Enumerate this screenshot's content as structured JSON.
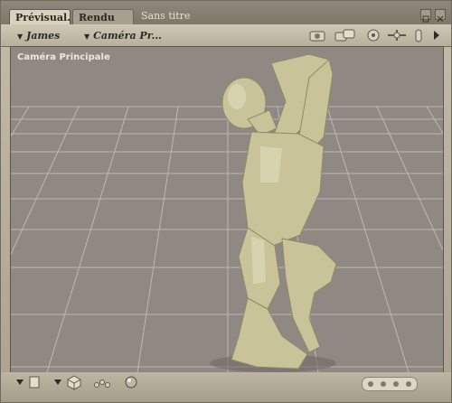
{
  "tabs": [
    {
      "label": "Prévisual.",
      "active": true
    },
    {
      "label": "Rendu",
      "active": false
    }
  ],
  "document": {
    "title": "Sans titre"
  },
  "toolbar": {
    "figure_dropdown": "James",
    "camera_dropdown": "Caméra Pr..."
  },
  "viewport": {
    "camera_label": "Caméra Principale",
    "background_color": "#8f8883",
    "figure_color": "#c9c39a"
  },
  "icons": {
    "window": [
      "restore-icon",
      "close-icon"
    ],
    "toolbar": [
      "camera-icon",
      "camera-set-icon",
      "target-icon",
      "move-icon",
      "lamp-icon",
      "arrow-right-icon"
    ],
    "bottom": [
      "menu-arrow-icon",
      "page-icon",
      "menu-arrow-icon",
      "cube-icon",
      "dots-icon",
      "sphere-icon",
      "nav-dots-icon"
    ]
  }
}
